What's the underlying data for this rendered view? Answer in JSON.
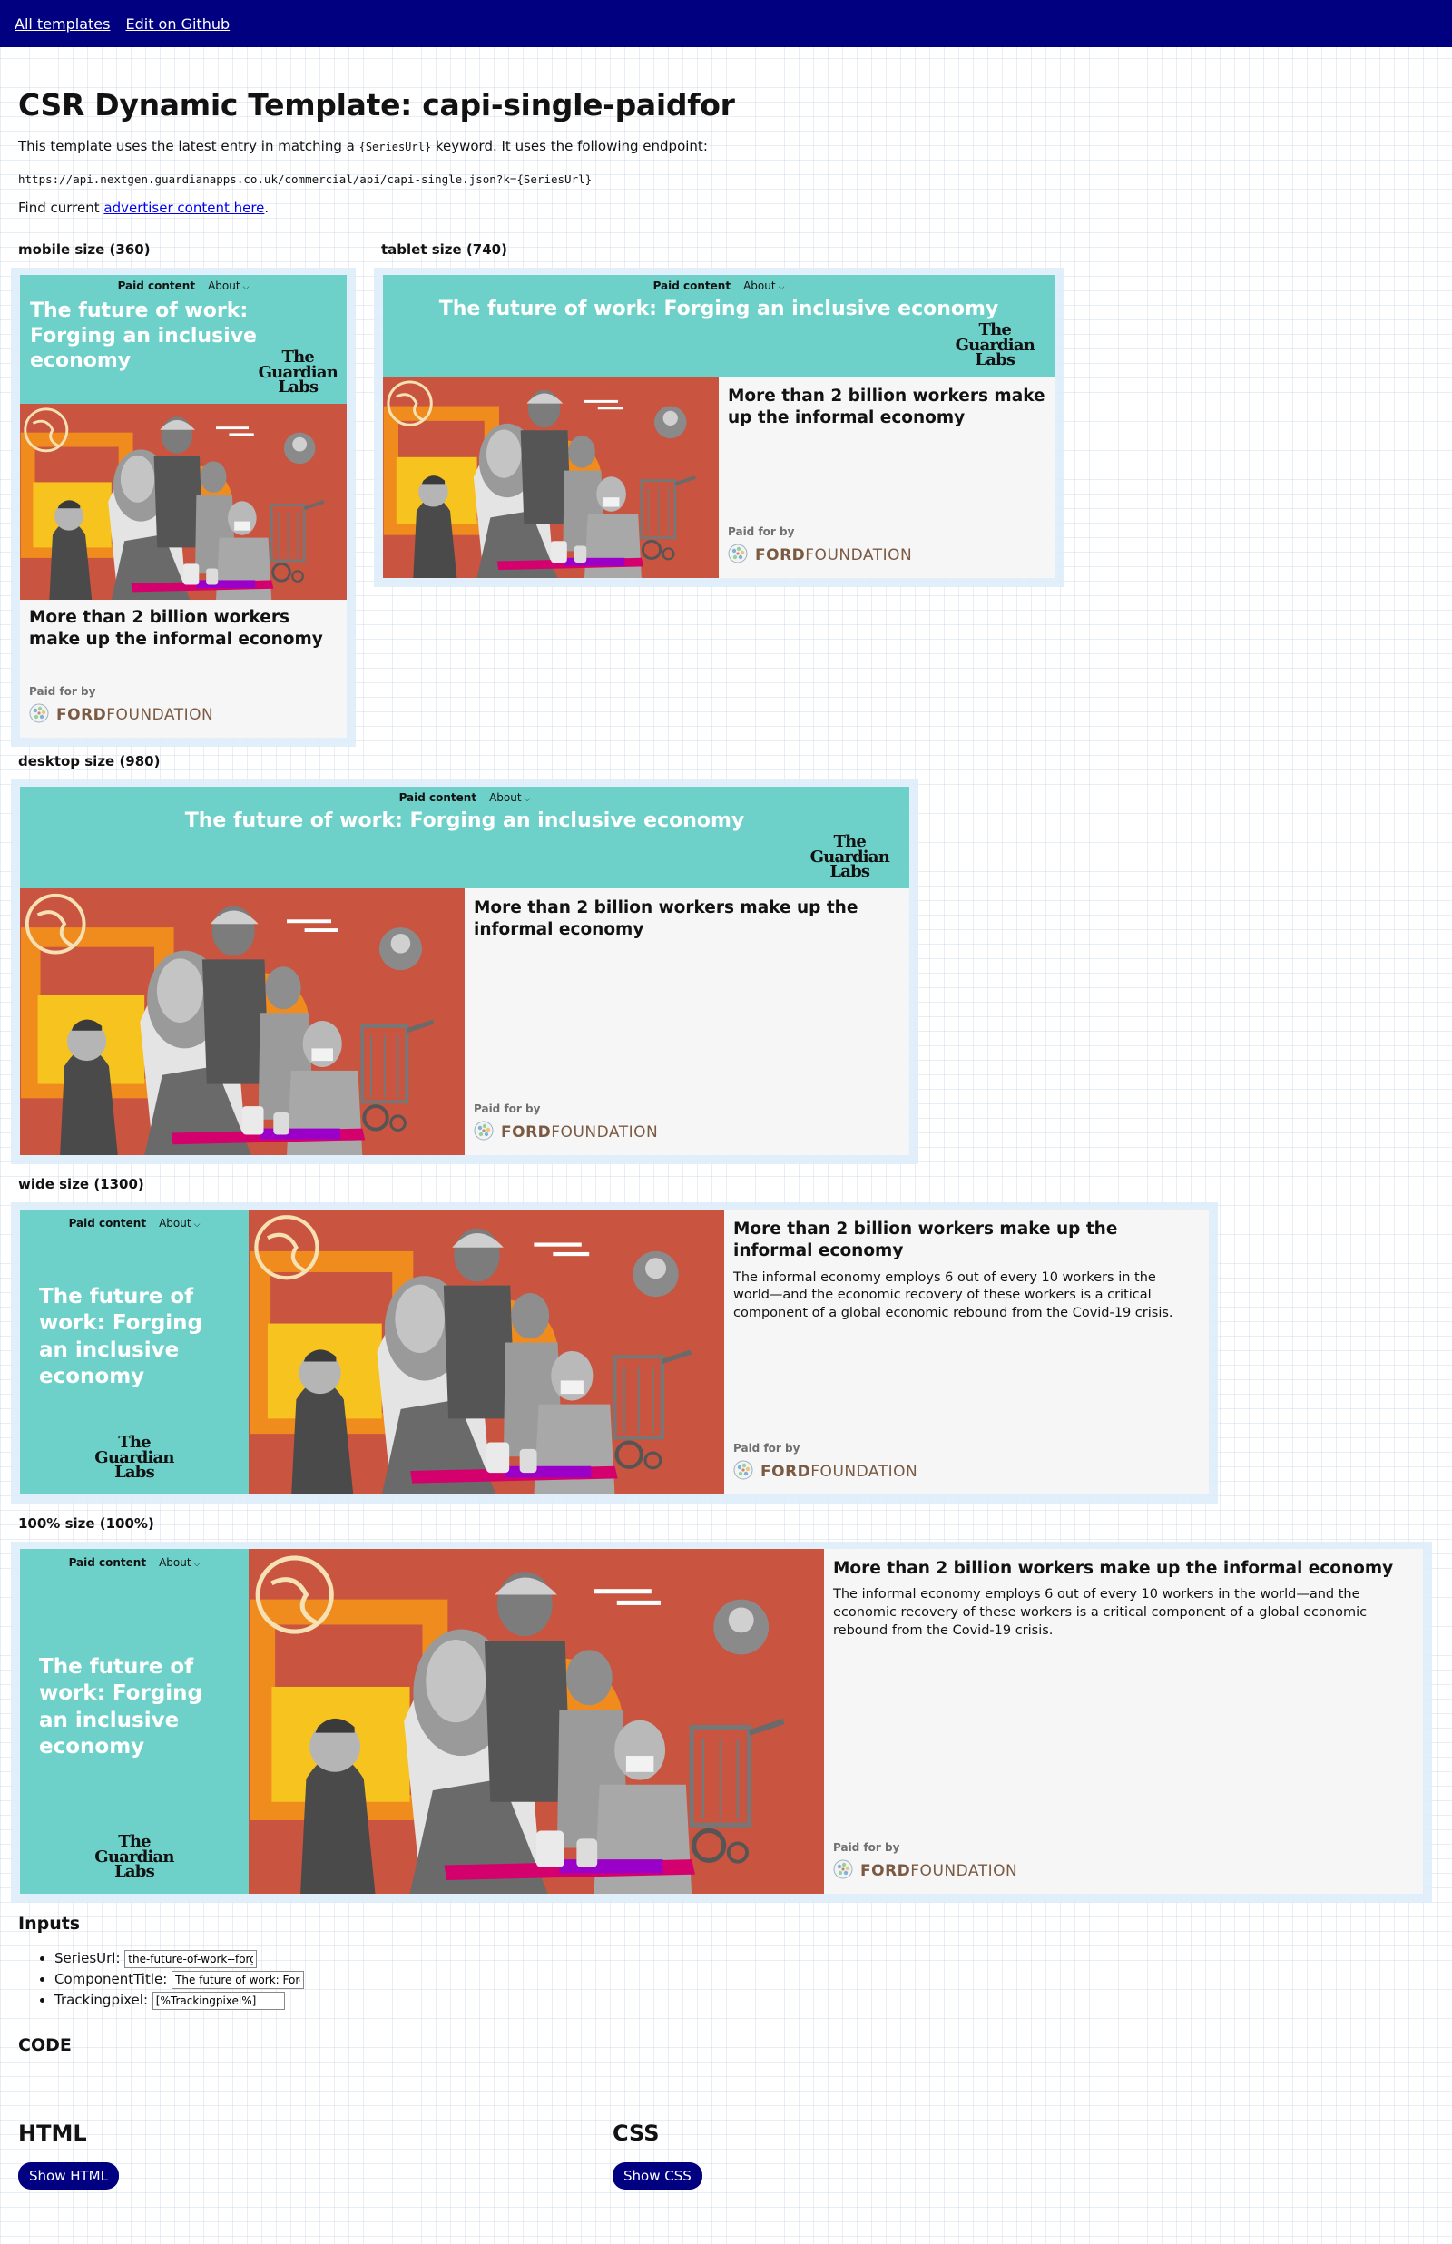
{
  "nav": {
    "all_templates": "All templates",
    "edit_github": "Edit on Github"
  },
  "page": {
    "title": "CSR Dynamic Template: capi-single-paidfor",
    "intro_before": "This template uses the latest entry in matching a ",
    "intro_code": "{SeriesUrl}",
    "intro_after": " keyword. It uses the following endpoint:",
    "endpoint": "https://api.nextgen.guardianapps.co.uk/commercial/api/capi-single.json?k={SeriesUrl}",
    "find_before": "Find current ",
    "find_link": "advertiser content here",
    "find_after": "."
  },
  "sizes": {
    "mobile": "mobile size (360)",
    "tablet": "tablet size (740)",
    "desktop": "desktop size (980)",
    "wide": "wide size (1300)",
    "full": "100% size (100%)"
  },
  "ad": {
    "paid_content": "Paid content",
    "about": "About",
    "series_title": "The future of work: Forging an inclusive economy",
    "logo_line1": "The",
    "logo_line2": "Guardian",
    "logo_line3": "Labs",
    "headline": "More than 2 billion workers make up the informal economy",
    "standfirst": "The informal economy employs 6 out of every 10 workers in the world—and the economic recovery of these workers is a critical component of a global economic rebound from the Covid-19 crisis.",
    "paid_for_by": "Paid for by",
    "sponsor_bold": "FORD",
    "sponsor_light": "FOUNDATION"
  },
  "inputs": {
    "heading": "Inputs",
    "series_label": "SeriesUrl:",
    "series_value": "the-future-of-work--forging-an-inclusive-economy",
    "component_label": "ComponentTitle:",
    "component_value": "The future of work: Forging an inclusive economy",
    "tracking_label": "Trackingpixel:",
    "tracking_value": "[%Trackingpixel%]"
  },
  "code": {
    "heading": "CODE",
    "html_heading": "HTML",
    "css_heading": "CSS",
    "show_html": "Show HTML",
    "show_css": "Show CSS"
  },
  "colors": {
    "nav_bg": "#000080",
    "teal": "#6dd1c9",
    "art_red": "#c9543f",
    "art_orange": "#f08c1e",
    "art_yellow": "#f7c31e",
    "frame": "#dcecf9"
  },
  "icons": {
    "chevron": "chevron-down-icon",
    "ford_seal": "ford-foundation-seal-icon"
  }
}
